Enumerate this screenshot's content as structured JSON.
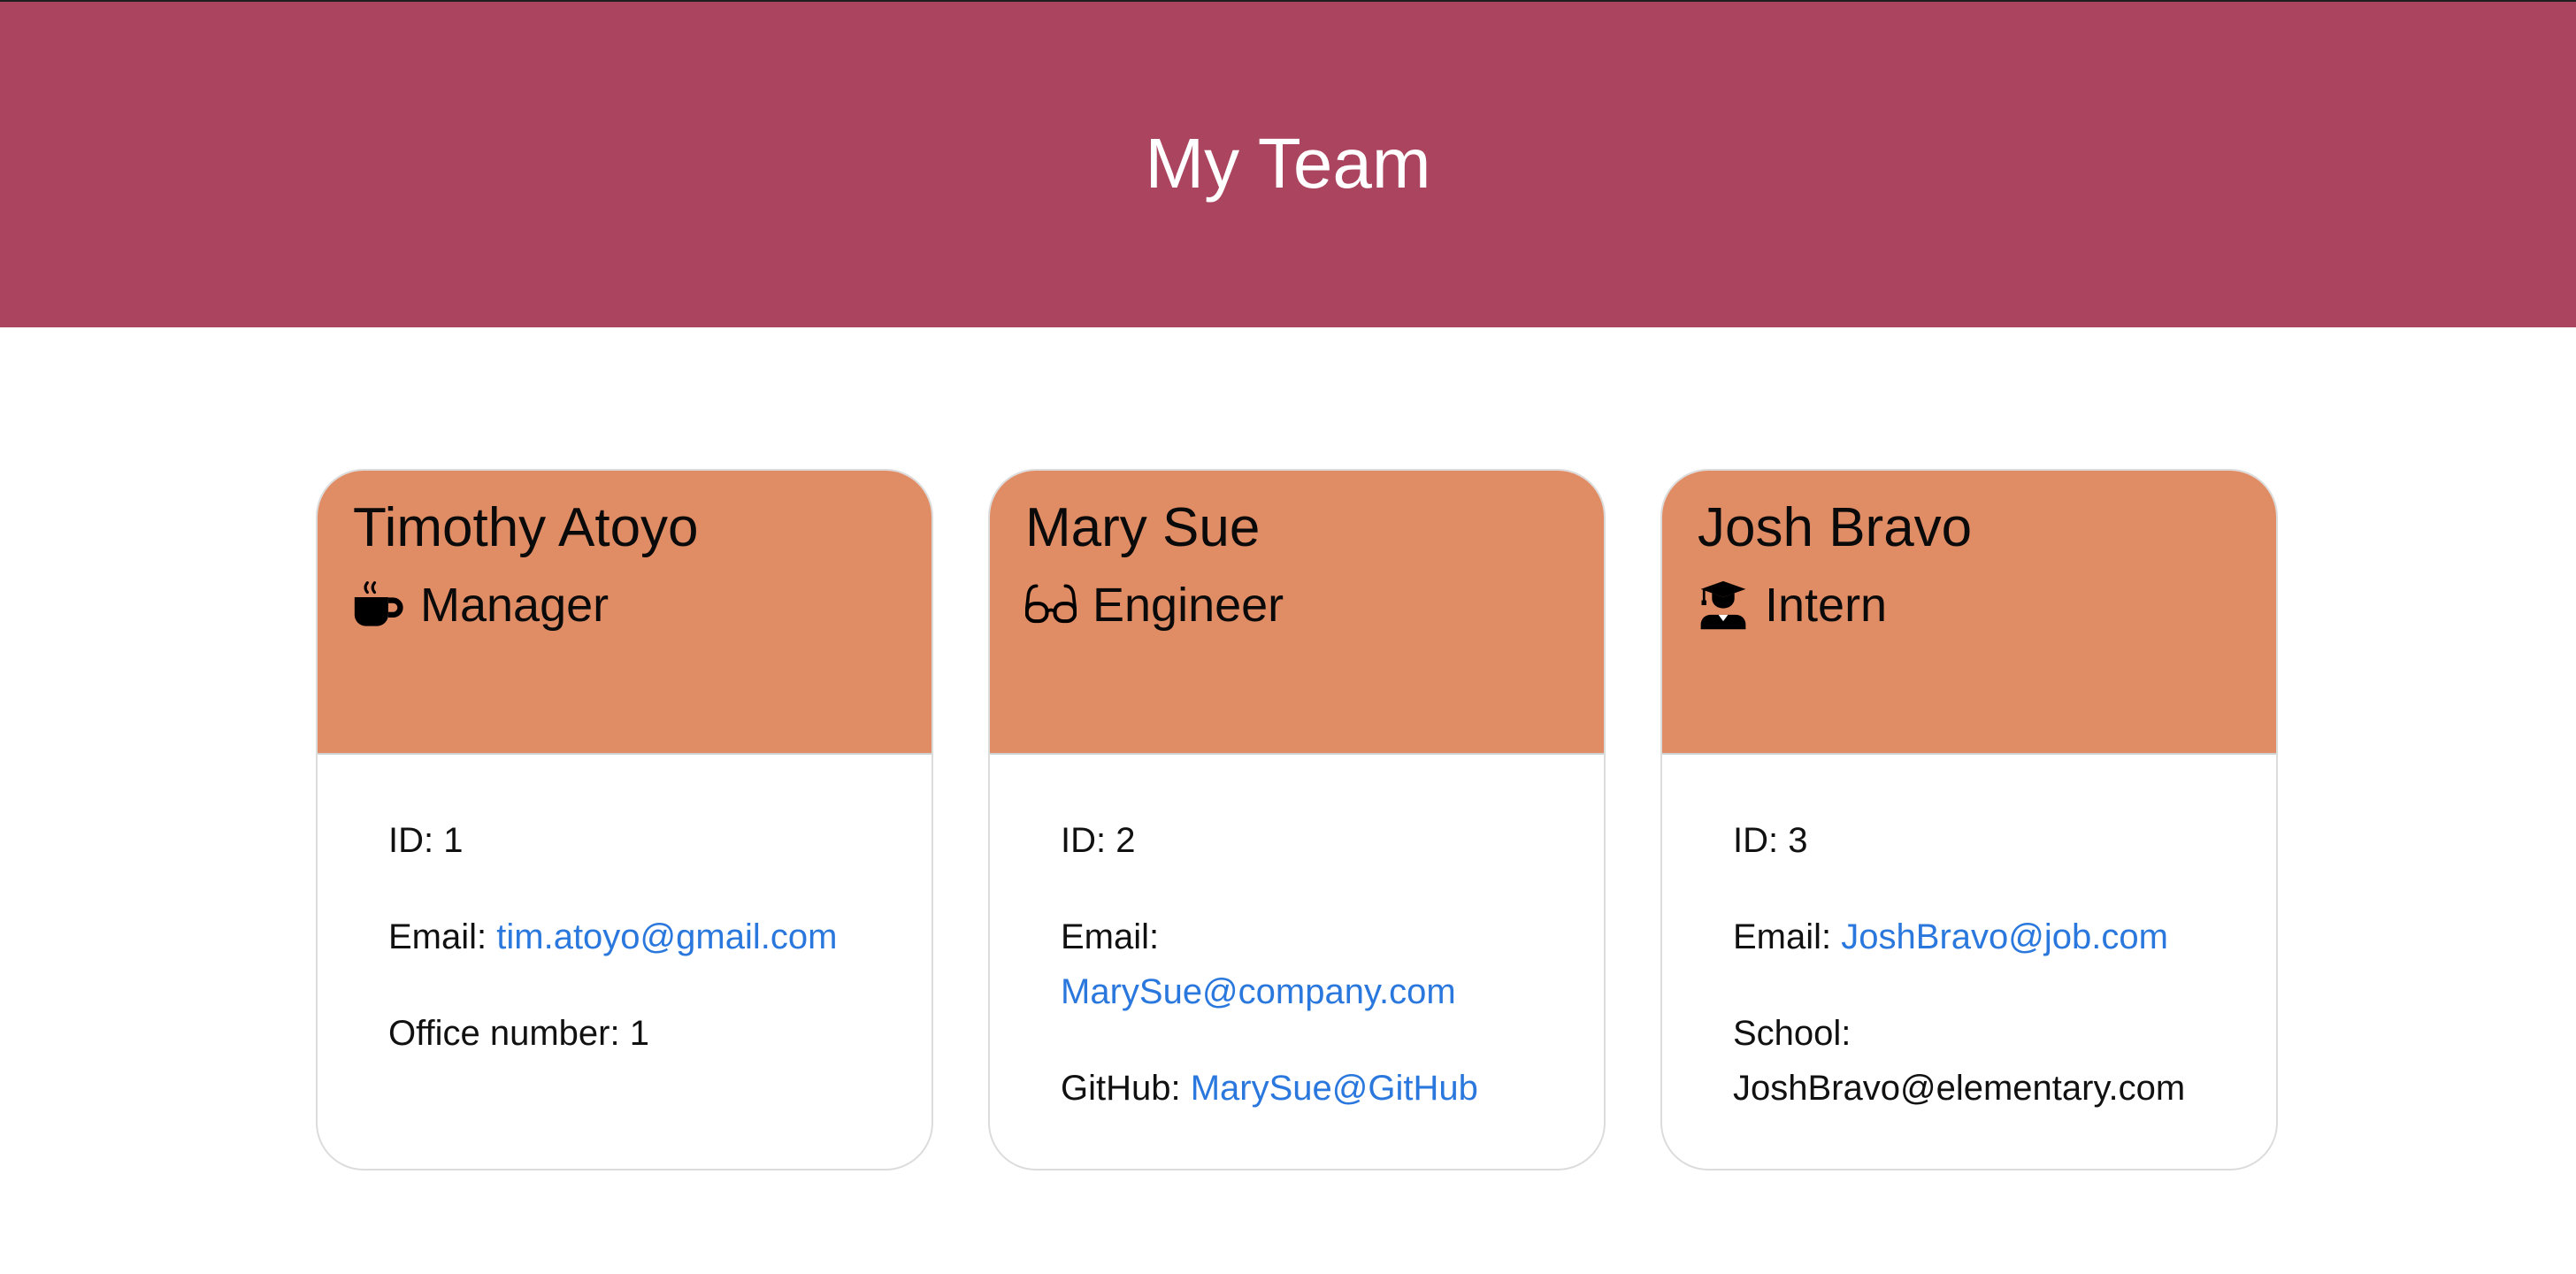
{
  "header": {
    "title": "My Team"
  },
  "colors": {
    "header_bg": "#ab445e",
    "card_header_bg": "#e08c64",
    "link": "#2a78dd"
  },
  "cards": [
    {
      "name": "Timothy Atoyo",
      "role": "Manager",
      "role_icon": "coffee-icon",
      "id_label": "ID: 1",
      "email_label": "Email:",
      "email": "tim.atoyo@gmail.com",
      "extra_label": "Office number: 1"
    },
    {
      "name": "Mary Sue",
      "role": "Engineer",
      "role_icon": "glasses-icon",
      "id_label": "ID: 2",
      "email_label": "Email:",
      "email": "MarySue@company.com",
      "extra_label": "GitHub:",
      "extra_link": "MarySue@GitHub"
    },
    {
      "name": "Josh Bravo",
      "role": "Intern",
      "role_icon": "graduate-icon",
      "id_label": "ID: 3",
      "email_label": "Email:",
      "email": "JoshBravo@job.com",
      "extra_label": "School:",
      "extra_value": "JoshBravo@elementary.com"
    }
  ]
}
